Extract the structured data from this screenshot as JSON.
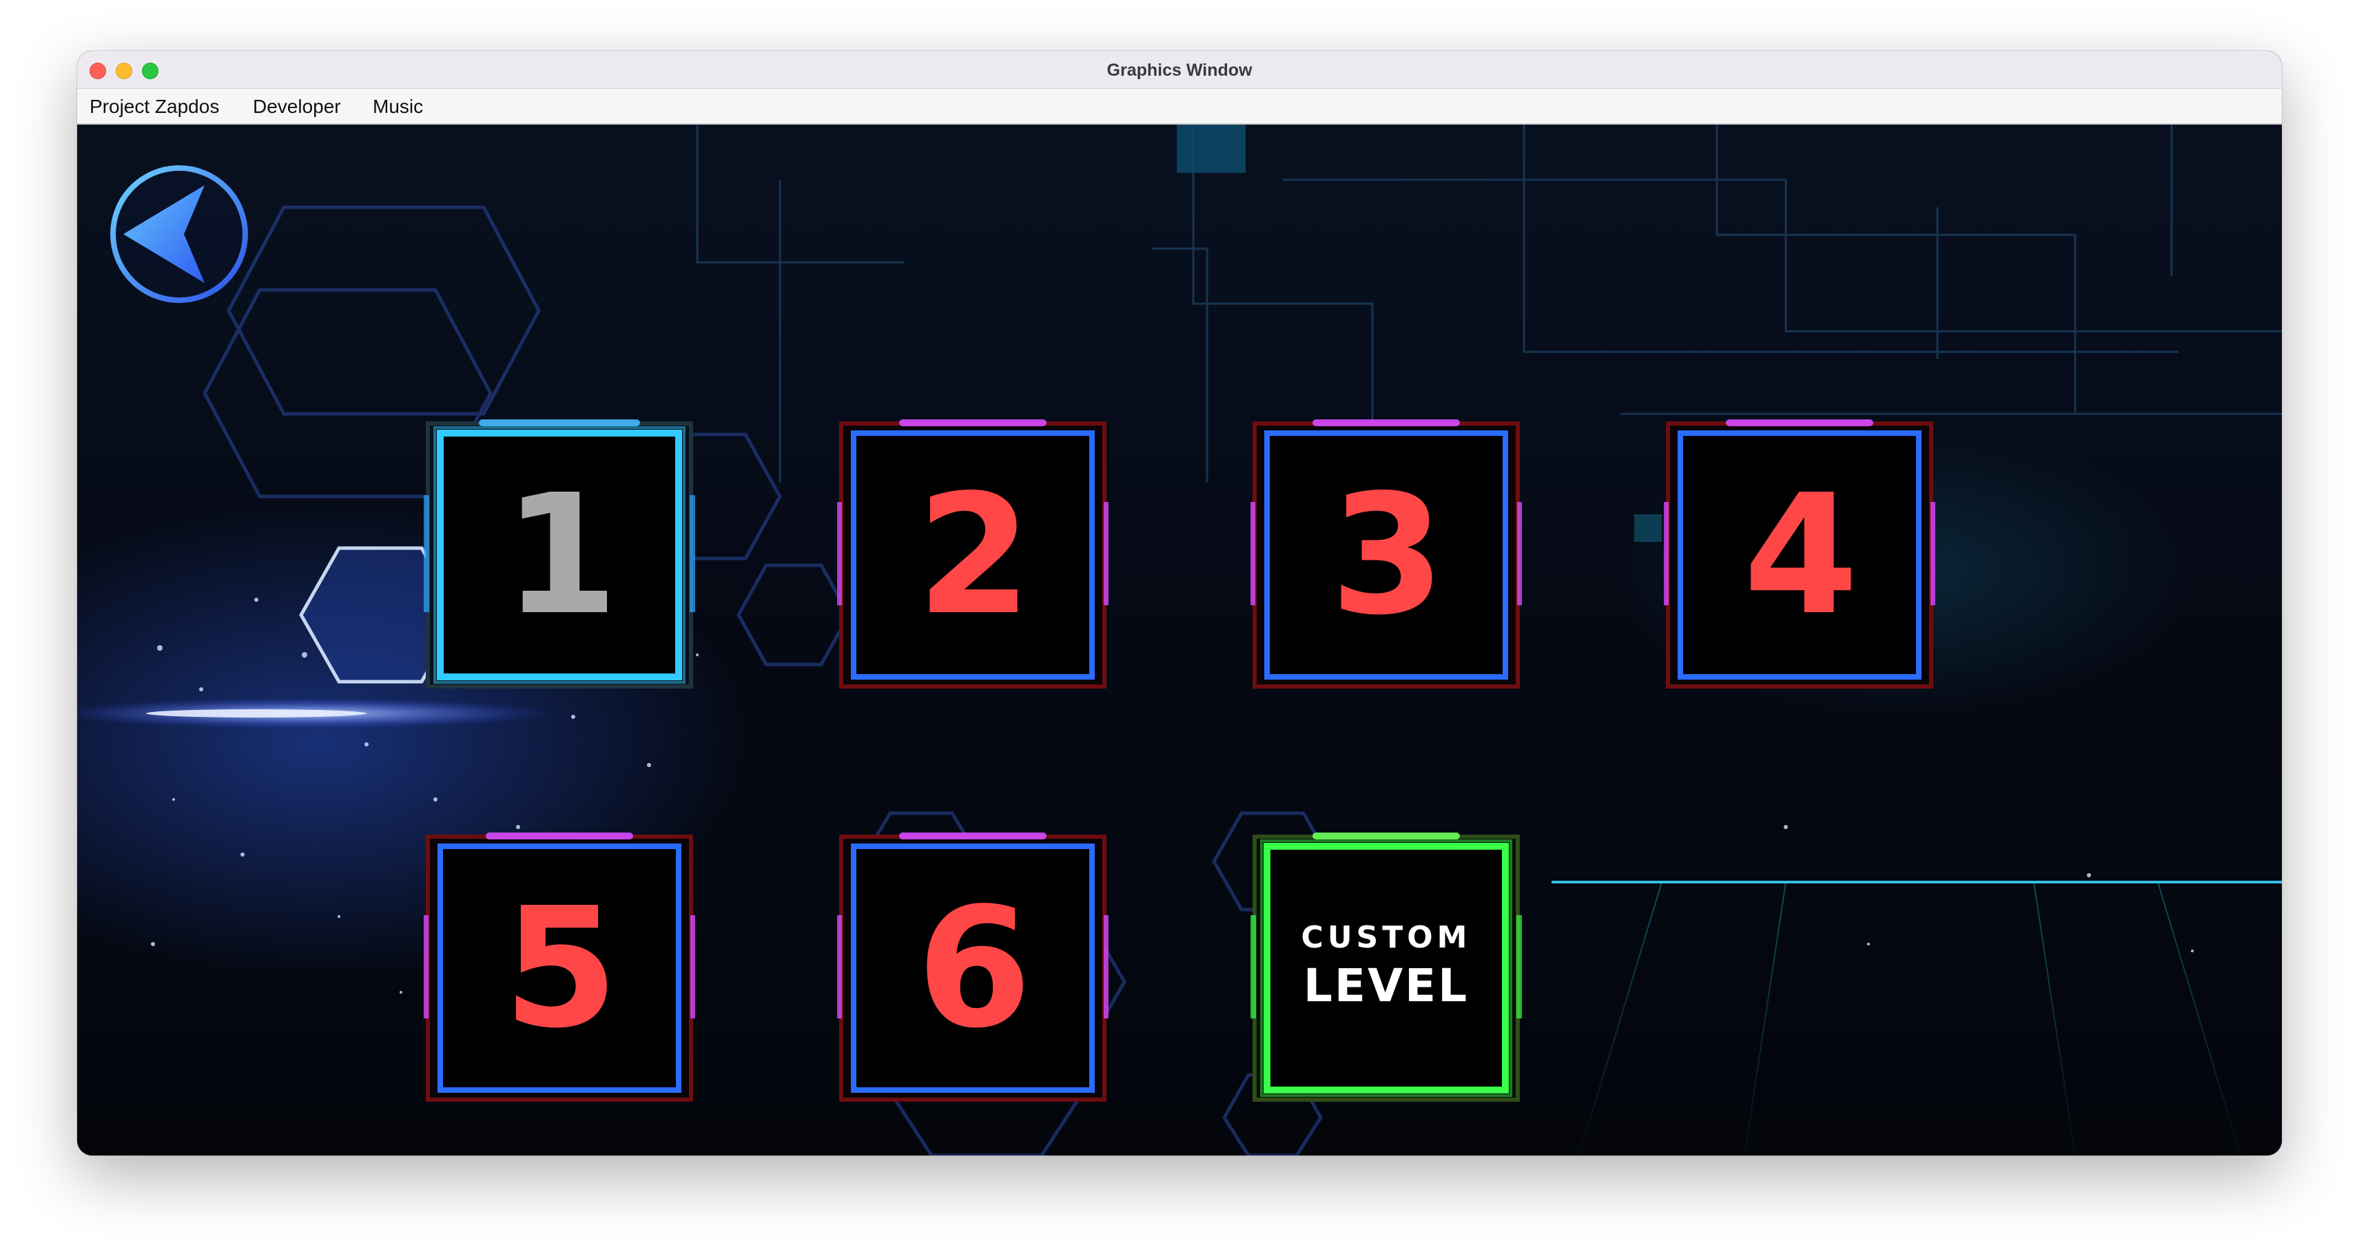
{
  "window": {
    "title": "Graphics Window"
  },
  "menu": {
    "items": [
      "Project Zapdos",
      "Developer",
      "Music"
    ]
  },
  "back_button": {
    "icon": "back-arrow-icon"
  },
  "levels": [
    {
      "label": "1",
      "state": "selected"
    },
    {
      "label": "2",
      "state": "normal"
    },
    {
      "label": "3",
      "state": "normal"
    },
    {
      "label": "4",
      "state": "normal"
    },
    {
      "label": "5",
      "state": "normal"
    },
    {
      "label": "6",
      "state": "normal"
    }
  ],
  "custom_level": {
    "line1": "CUSTOM",
    "line2": "LEVEL"
  },
  "colors": {
    "number_red": "#ff4747",
    "number_grey": "#a9a9a9",
    "selected_glow": "#2fc8ff",
    "tile_border_blue": "#2a6cff",
    "custom_glow": "#39ff4a"
  }
}
